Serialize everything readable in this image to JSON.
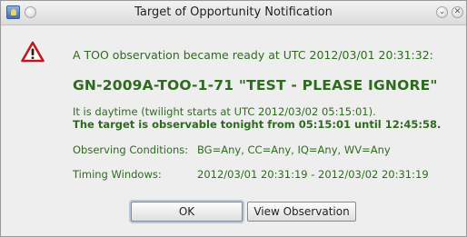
{
  "window": {
    "title": "Target of Opportunity Notification",
    "minimize_glyph": "⌄",
    "close_glyph": "✕"
  },
  "message": {
    "ready_line": "A TOO observation became ready at UTC 2012/03/01 20:31:32:",
    "observation_id": "GN-2009A-TOO-1-71 \"TEST - PLEASE IGNORE\"",
    "daytime_line": "It is daytime (twilight starts at UTC 2012/03/02 05:15:01).",
    "observable_line": "The target is observable tonight from 05:15:01 until 12:45:58.",
    "conditions_label": "Observing Conditions:",
    "conditions_value": "BG=Any, CC=Any, IQ=Any, WV=Any",
    "timing_label": "Timing Windows:",
    "timing_value": "2012/03/01 20:31:19 - 2012/03/02 20:31:19"
  },
  "buttons": {
    "ok_label": "OK",
    "view_label": "View Observation"
  },
  "icons": {
    "app": "app-icon",
    "warning": "warning-triangle-icon"
  },
  "colors": {
    "text_green": "#2e6b1f",
    "warning_red": "#c4161c",
    "background": "#eeeeee"
  }
}
